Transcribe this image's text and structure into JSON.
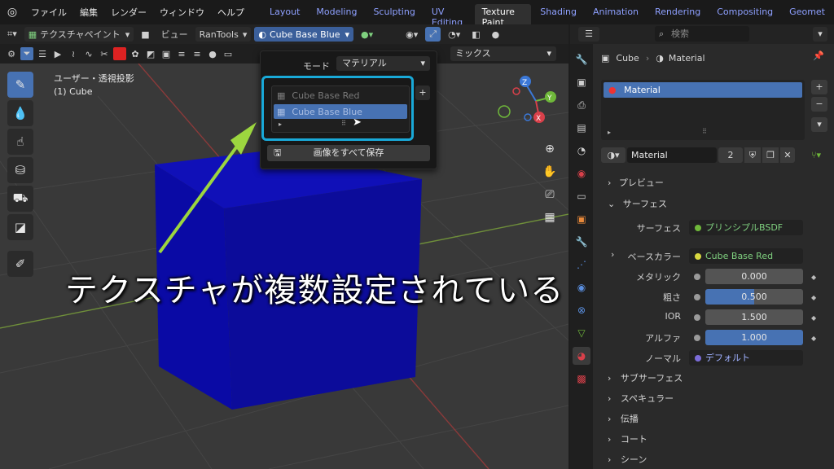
{
  "menu": {
    "items": [
      "ファイル",
      "編集",
      "レンダー",
      "ウィンドウ",
      "ヘルプ"
    ]
  },
  "workspaces": [
    "Layout",
    "Modeling",
    "Sculpting",
    "UV Editing",
    "Texture Paint",
    "Shading",
    "Animation",
    "Rendering",
    "Compositing",
    "Geomet"
  ],
  "header": {
    "mode": "テクスチャペイント",
    "view": "ビュー",
    "rantools": "RanTools",
    "image": "Cube Base Blue",
    "blend": "ミックス"
  },
  "viewport": {
    "projection": "ユーザー・透視投影",
    "object": "(1) Cube",
    "caption": "テクスチャが複数設定されている"
  },
  "popup": {
    "mode_label": "モード",
    "mode_value": "マテリアル",
    "textures": [
      "Cube Base Red",
      "Cube Base Blue"
    ],
    "selected_index": 1,
    "save_all": "画像をすべて保存"
  },
  "properties": {
    "search_placeholder": "検索",
    "breadcrumb_object": "Cube",
    "breadcrumb_material": "Material",
    "slot": "Material",
    "material_name": "Material",
    "users": "2",
    "sections": {
      "preview": "プレビュー",
      "surface": "サーフェス"
    },
    "surface_label": "サーフェス",
    "surface_value": "プリンシプルBSDF",
    "base_color_label": "ベースカラー",
    "base_color_value": "Cube Base Red",
    "metallic_label": "メタリック",
    "metallic_value": "0.000",
    "roughness_label": "粗さ",
    "roughness_value": "0.500",
    "ior_label": "IOR",
    "ior_value": "1.500",
    "alpha_label": "アルファ",
    "alpha_value": "1.000",
    "normal_label": "ノーマル",
    "normal_value": "デフォルト",
    "subsections": [
      "サブサーフェス",
      "スペキュラー",
      "伝播",
      "コート",
      "シーン"
    ]
  },
  "colors": {
    "accent": "#4772b3",
    "highlight": "#19a9d8",
    "cube": "#0a0a9e"
  }
}
